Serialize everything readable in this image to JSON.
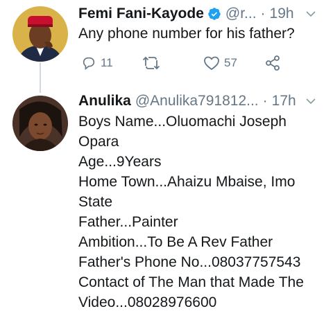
{
  "tweets": [
    {
      "name": "Femi Fani-Kayode",
      "handle": "@r...",
      "dot": "·",
      "time": "19h",
      "text_lines": [
        "Any phone number for his father?"
      ],
      "replies": "11",
      "likes": "57"
    },
    {
      "name": "Anulika",
      "handle": "@Anulika791812...",
      "dot": "·",
      "time": "17h",
      "text_lines": [
        "Boys Name...Oluomachi Joseph",
        "Opara",
        "Age...9Years",
        "Home Town...Ahaizu Mbaise, Imo",
        "State",
        "Father...Painter",
        "Ambition...To Be A Rev Father",
        "Father's Phone No...08037757543",
        "Contact of The Man that Made The",
        "Video...08028976600"
      ]
    }
  ],
  "icons": [
    "verified-badge-icon",
    "chevron-down-icon",
    "reply-icon",
    "retweet-icon",
    "like-icon",
    "share-icon"
  ],
  "colors": {
    "verified": "#1da1f2",
    "meta": "#657786",
    "text": "#14171a"
  }
}
